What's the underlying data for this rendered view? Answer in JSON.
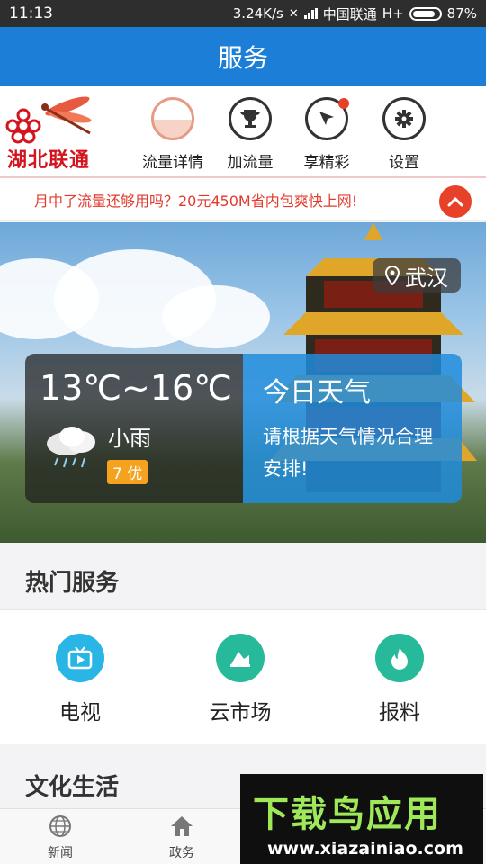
{
  "status_bar": {
    "time": "11:13",
    "net_speed": "3.24K/s",
    "carrier": "中国联通",
    "network": "H+",
    "battery": "87%"
  },
  "header": {
    "title": "服务"
  },
  "brand": {
    "logo_text": "湖北联通"
  },
  "quick_services": [
    {
      "label": "流量详情",
      "icon": "data-usage-icon"
    },
    {
      "label": "加流量",
      "icon": "trophy-icon"
    },
    {
      "label": "享精彩",
      "icon": "cursor-icon"
    },
    {
      "label": "设置",
      "icon": "gear-icon"
    }
  ],
  "notice": {
    "text": "月中了流量还够用吗？20元450M省内包爽快上网!"
  },
  "weather": {
    "location": "武汉",
    "temperature": "13℃~16℃",
    "condition": "小雨",
    "aqi": "7 优",
    "tip_title": "今日天气",
    "tip_body": "请根据天气情况合理安排!"
  },
  "hot_services": {
    "title": "热门服务",
    "items": [
      {
        "label": "电视",
        "icon": "tv-icon",
        "color": "#29b6e6"
      },
      {
        "label": "云市场",
        "icon": "market-icon",
        "color": "#26b99a"
      },
      {
        "label": "报料",
        "icon": "fire-icon",
        "color": "#26b99a"
      }
    ]
  },
  "culture": {
    "title": "文化生活"
  },
  "bottom_nav": [
    {
      "label": "新闻",
      "icon": "globe-icon"
    },
    {
      "label": "政务",
      "icon": "home-icon"
    }
  ],
  "watermark": {
    "title": "下载鸟应用",
    "url": "www.xiazainiao.com"
  },
  "colors": {
    "primary": "#1c7ed6",
    "accent_red": "#e8412a",
    "notice_red": "#e23a2c"
  }
}
